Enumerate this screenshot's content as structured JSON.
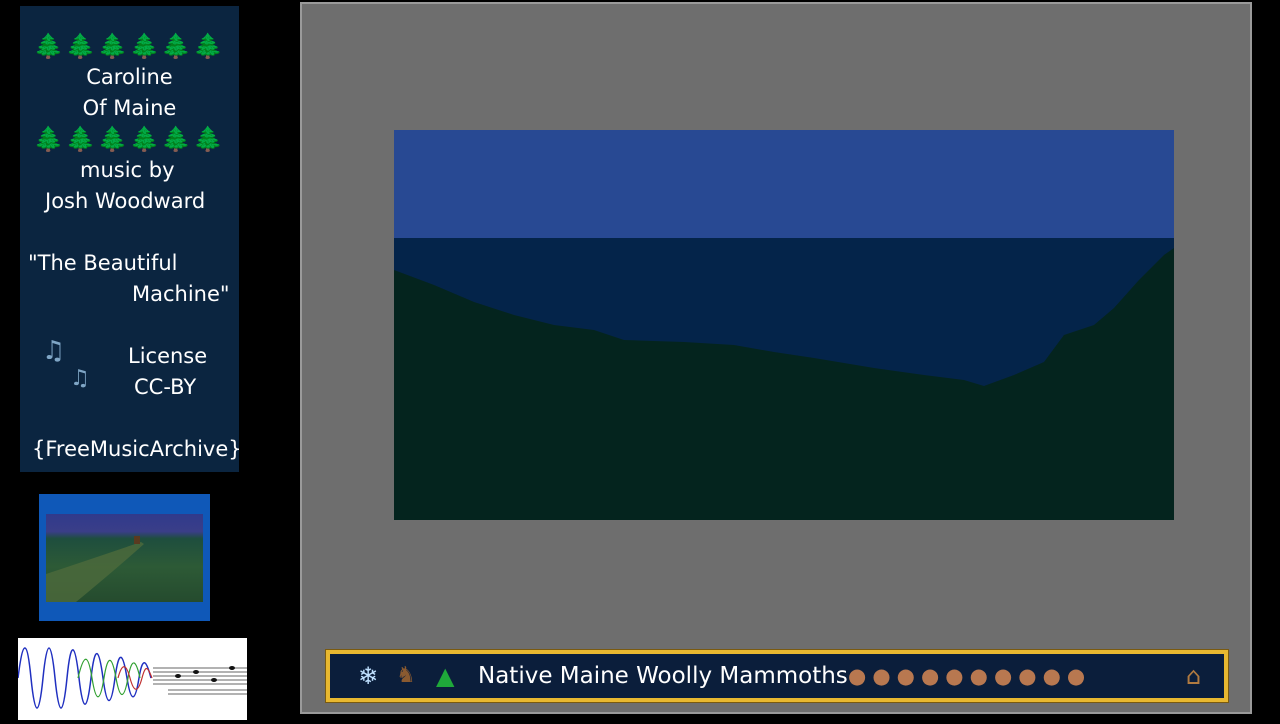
{
  "info": {
    "trees": "🌲🌲🌲🌲🌲🌲",
    "title_line1": "Caroline",
    "title_line2": "Of Maine",
    "credit_line1": "music by",
    "credit_line2": "Josh Woodward",
    "song_line1": "\"The Beautiful",
    "song_line2": "Machine\"",
    "music_note_icon": "♫",
    "license_label": "License",
    "license_value": "CC-BY",
    "source": "{FreeMusicArchive}"
  },
  "banner": {
    "text": "Native Maine Woolly Mammoths",
    "icons": [
      "snowflake-icon",
      "moose-icon",
      "pine-tree-icon",
      "mammoth-icon",
      "cave-icon"
    ]
  },
  "colors": {
    "panel_bg": "#0b2540",
    "viewer_bg": "#6e6e6e",
    "sky": "#284993",
    "night": "#04244a",
    "ground": "#04241e",
    "banner_border": "#e8b830",
    "banner_bg": "#0b1e3b"
  }
}
